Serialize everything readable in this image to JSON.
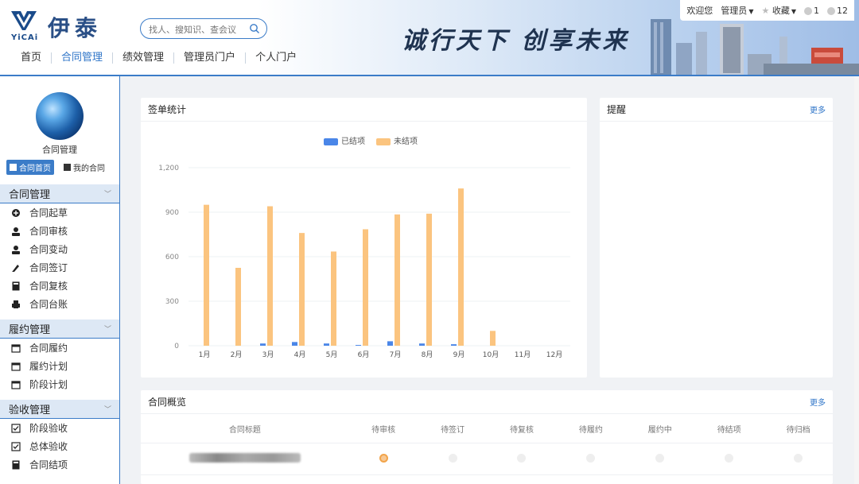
{
  "header": {
    "logo_cn": "伊泰",
    "logo_latin": "YiCAi",
    "search_placeholder": "找人、搜知识、查会议",
    "slogan": "诚行天下 创享未来",
    "welcome": "欢迎您",
    "user": "管理员",
    "favorites": "收藏",
    "notice_count": "1",
    "message_count": "12",
    "nav": [
      {
        "label": "首页",
        "active": false
      },
      {
        "label": "合同管理",
        "active": true
      },
      {
        "label": "绩效管理",
        "active": false
      },
      {
        "label": "管理员门户",
        "active": false
      },
      {
        "label": "个人门户",
        "active": false
      }
    ],
    "accent_color": "#2f75c8"
  },
  "sidebar": {
    "title": "合同管理",
    "quick": [
      {
        "label": "合同首页",
        "icon": "grid-icon",
        "active": true
      },
      {
        "label": "我的合同",
        "icon": "document-icon",
        "active": false
      }
    ],
    "groups": [
      {
        "label": "合同管理",
        "items": [
          {
            "label": "合同起草",
            "icon": "plus-circle-icon"
          },
          {
            "label": "合同审核",
            "icon": "user-icon"
          },
          {
            "label": "合同变动",
            "icon": "user-icon"
          },
          {
            "label": "合同签订",
            "icon": "pen-icon"
          },
          {
            "label": "合同复核",
            "icon": "calculator-icon"
          },
          {
            "label": "合同台账",
            "icon": "printer-icon"
          }
        ]
      },
      {
        "label": "履约管理",
        "items": [
          {
            "label": "合同履约",
            "icon": "calendar-icon"
          },
          {
            "label": "履约计划",
            "icon": "calendar-icon"
          },
          {
            "label": "阶段计划",
            "icon": "calendar-icon"
          }
        ]
      },
      {
        "label": "验收管理",
        "items": [
          {
            "label": "阶段验收",
            "icon": "checkbox-icon"
          },
          {
            "label": "总体验收",
            "icon": "checkbox-icon"
          },
          {
            "label": "合同结项",
            "icon": "calculator-icon"
          }
        ]
      }
    ]
  },
  "sign_panel": {
    "title": "签单统计"
  },
  "reminder_panel": {
    "title": "提醒",
    "more": "更多"
  },
  "overview_panel": {
    "title": "合同概览",
    "more": "更多",
    "columns": [
      "合同标题",
      "待审核",
      "待签订",
      "待复核",
      "待履约",
      "履约中",
      "待结项",
      "待归档"
    ],
    "rows": [
      {
        "title_hidden": true,
        "status_index": 0
      }
    ]
  },
  "chart_data": {
    "type": "bar",
    "categories": [
      "1月",
      "2月",
      "3月",
      "4月",
      "5月",
      "6月",
      "7月",
      "8月",
      "9月",
      "10月",
      "11月",
      "12月"
    ],
    "series": [
      {
        "name": "已结项",
        "color": "#4a86e8",
        "values": [
          0,
          0,
          15,
          25,
          15,
          5,
          30,
          15,
          10,
          0,
          0,
          0
        ]
      },
      {
        "name": "未结项",
        "color": "#fbc47f",
        "values": [
          950,
          525,
          940,
          760,
          635,
          785,
          885,
          890,
          1060,
          100,
          0,
          0
        ]
      }
    ],
    "yticks": [
      0,
      300,
      600,
      900,
      1200
    ],
    "ytick_labels": [
      "0",
      "300",
      "600",
      "900",
      "1,200"
    ],
    "ylim": [
      0,
      1200
    ],
    "legend": "top-center",
    "grid": true
  }
}
